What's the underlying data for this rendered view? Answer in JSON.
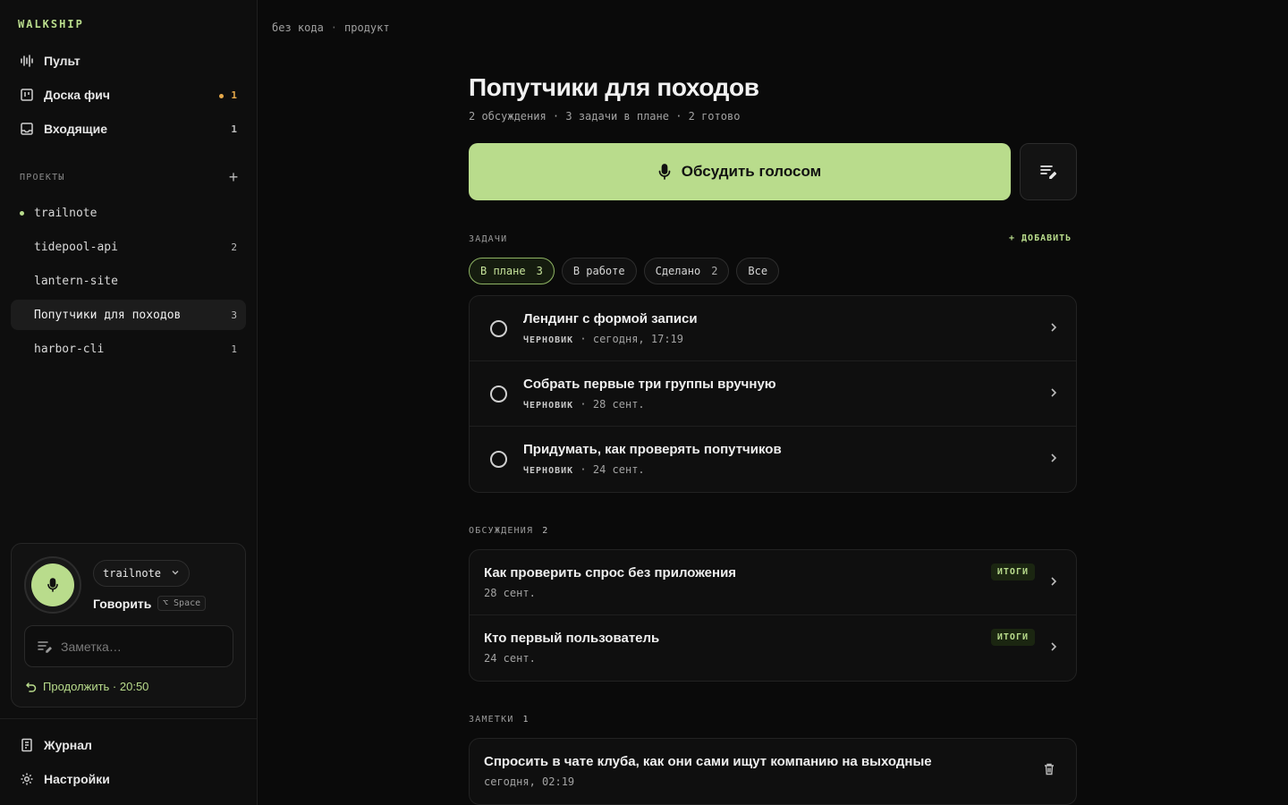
{
  "sidebar": {
    "brand": "WALKSHIP",
    "nav": [
      {
        "label": "Пульт",
        "icon": "waveform-icon",
        "count": ""
      },
      {
        "label": "Доска фич",
        "icon": "board-icon",
        "count": "1",
        "dot": true
      },
      {
        "label": "Входящие",
        "icon": "inbox-icon",
        "count": "1"
      }
    ],
    "projects_label": "ПРОЕКТЫ",
    "projects": [
      {
        "name": "trailnote",
        "count": "",
        "dot": true
      },
      {
        "name": "tidepool-api",
        "count": "2"
      },
      {
        "name": "lantern-site",
        "count": ""
      },
      {
        "name": "Попутчики для походов",
        "count": "3",
        "active": true
      },
      {
        "name": "harbor-cli",
        "count": "1"
      }
    ],
    "voice": {
      "project": "trailnote",
      "speak_label": "Говорить",
      "shortcut": "⌥ Space",
      "note_placeholder": "Заметка…",
      "continue_label": "Продолжить · 20:50"
    },
    "bottom": [
      {
        "label": "Журнал",
        "icon": "journal-icon"
      },
      {
        "label": "Настройки",
        "icon": "gear-icon"
      }
    ]
  },
  "breadcrumb": [
    "без кода",
    "продукт"
  ],
  "page": {
    "title": "Попутчики для походов",
    "meta": "2 обсуждения · 3 задачи в плане · 2 готово",
    "voice_button": "Обсудить голосом"
  },
  "tasks": {
    "label": "ЗАДАЧИ",
    "add_label": "+ ДОБАВИТЬ",
    "filters": [
      {
        "label": "В плане",
        "count": "3",
        "active": true
      },
      {
        "label": "В работе",
        "count": ""
      },
      {
        "label": "Сделано",
        "count": "2"
      },
      {
        "label": "Все",
        "count": ""
      }
    ],
    "items": [
      {
        "title": "Лендинг с формой записи",
        "tag": "ЧЕРНОВИК",
        "date": "сегодня, 17:19"
      },
      {
        "title": "Собрать первые три группы вручную",
        "tag": "ЧЕРНОВИК",
        "date": "28 сент."
      },
      {
        "title": "Придумать, как проверять попутчиков",
        "tag": "ЧЕРНОВИК",
        "date": "24 сент."
      }
    ]
  },
  "discussions": {
    "label": "ОБСУЖДЕНИЯ",
    "count": "2",
    "items": [
      {
        "title": "Как проверить спрос без приложения",
        "date": "28 сент.",
        "badge": "ИТОГИ"
      },
      {
        "title": "Кто первый пользователь",
        "date": "24 сент.",
        "badge": "ИТОГИ"
      }
    ]
  },
  "notes": {
    "label": "ЗАМЕТКИ",
    "count": "1",
    "items": [
      {
        "title": "Спросить в чате клуба, как они сами ищут компанию на выходные",
        "date": "сегодня, 02:19"
      }
    ]
  },
  "colors": {
    "accent": "#b9dc8c",
    "warning": "#e6a94a",
    "background": "#0a0a0a"
  }
}
